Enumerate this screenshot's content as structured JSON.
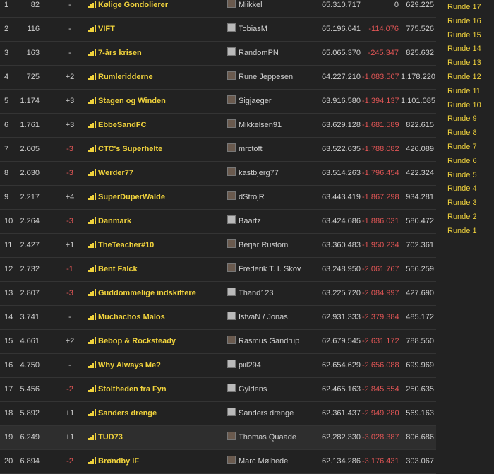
{
  "standings": [
    {
      "rank": "1",
      "prev": "82",
      "move": "-",
      "team": "Kølige Gondolierer",
      "user": "Miikkel",
      "avatar": "dark",
      "points": "65.310.717",
      "diff": "0",
      "last": "629.225"
    },
    {
      "rank": "2",
      "prev": "116",
      "move": "-",
      "team": "VIFT",
      "user": "TobiasM",
      "avatar": "light",
      "points": "65.196.641",
      "diff": "-114.076",
      "last": "775.526"
    },
    {
      "rank": "3",
      "prev": "163",
      "move": "-",
      "team": "7-års krisen",
      "user": "RandomPN",
      "avatar": "light",
      "points": "65.065.370",
      "diff": "-245.347",
      "last": "825.632"
    },
    {
      "rank": "4",
      "prev": "725",
      "move": "+2",
      "team": "Rumleridderne",
      "user": "Rune Jeppesen",
      "avatar": "dark",
      "points": "64.227.210",
      "diff": "-1.083.507",
      "last": "1.178.220"
    },
    {
      "rank": "5",
      "prev": "1.174",
      "move": "+3",
      "team": "Stagen og Winden",
      "user": "Sigjaeger",
      "avatar": "dark",
      "points": "63.916.580",
      "diff": "-1.394.137",
      "last": "1.101.085"
    },
    {
      "rank": "6",
      "prev": "1.761",
      "move": "+3",
      "team": "EbbeSandFC",
      "user": "Mikkelsen91",
      "avatar": "dark",
      "points": "63.629.128",
      "diff": "-1.681.589",
      "last": "822.615"
    },
    {
      "rank": "7",
      "prev": "2.005",
      "move": "-3",
      "team": "CTC's Superhelte",
      "user": "mrctoft",
      "avatar": "dark",
      "points": "63.522.635",
      "diff": "-1.788.082",
      "last": "426.089"
    },
    {
      "rank": "8",
      "prev": "2.030",
      "move": "-3",
      "team": "Werder77",
      "user": "kastbjerg77",
      "avatar": "dark",
      "points": "63.514.263",
      "diff": "-1.796.454",
      "last": "422.324"
    },
    {
      "rank": "9",
      "prev": "2.217",
      "move": "+4",
      "team": "SuperDuperWalde",
      "user": "dStrojR",
      "avatar": "dark",
      "points": "63.443.419",
      "diff": "-1.867.298",
      "last": "934.281"
    },
    {
      "rank": "10",
      "prev": "2.264",
      "move": "-3",
      "team": "Danmark",
      "user": "Baartz",
      "avatar": "light",
      "points": "63.424.686",
      "diff": "-1.886.031",
      "last": "580.472"
    },
    {
      "rank": "11",
      "prev": "2.427",
      "move": "+1",
      "team": "TheTeacher#10",
      "user": "Berjar Rustom",
      "avatar": "dark",
      "points": "63.360.483",
      "diff": "-1.950.234",
      "last": "702.361"
    },
    {
      "rank": "12",
      "prev": "2.732",
      "move": "-1",
      "team": "Bent Falck",
      "user": "Frederik T. I. Skov",
      "avatar": "dark",
      "points": "63.248.950",
      "diff": "-2.061.767",
      "last": "556.259"
    },
    {
      "rank": "13",
      "prev": "2.807",
      "move": "-3",
      "team": "Guddommelige indskiftere",
      "user": "Thand123",
      "avatar": "light",
      "points": "63.225.720",
      "diff": "-2.084.997",
      "last": "427.690"
    },
    {
      "rank": "14",
      "prev": "3.741",
      "move": "-",
      "team": "Muchachos Malos",
      "user": "IstvaN / Jonas",
      "avatar": "light",
      "points": "62.931.333",
      "diff": "-2.379.384",
      "last": "485.172"
    },
    {
      "rank": "15",
      "prev": "4.661",
      "move": "+2",
      "team": "Bebop & Rocksteady",
      "user": "Rasmus Gandrup",
      "avatar": "dark",
      "points": "62.679.545",
      "diff": "-2.631.172",
      "last": "788.550"
    },
    {
      "rank": "16",
      "prev": "4.750",
      "move": "-",
      "team": "Why Always Me?",
      "user": "piil294",
      "avatar": "light",
      "points": "62.654.629",
      "diff": "-2.656.088",
      "last": "699.969"
    },
    {
      "rank": "17",
      "prev": "5.456",
      "move": "-2",
      "team": "Stoltheden fra Fyn",
      "user": "Gyldens",
      "avatar": "light",
      "points": "62.465.163",
      "diff": "-2.845.554",
      "last": "250.635"
    },
    {
      "rank": "18",
      "prev": "5.892",
      "move": "+1",
      "team": "Sanders drenge",
      "user": "Sanders drenge",
      "avatar": "light",
      "points": "62.361.437",
      "diff": "-2.949.280",
      "last": "569.163"
    },
    {
      "rank": "19",
      "prev": "6.249",
      "move": "+1",
      "team": "TUD73",
      "user": "Thomas Quaade",
      "avatar": "dark",
      "points": "62.282.330",
      "diff": "-3.028.387",
      "last": "806.686"
    },
    {
      "rank": "20",
      "prev": "6.894",
      "move": "-2",
      "team": "Brøndby IF",
      "user": "Marc Mølhede",
      "avatar": "dark",
      "points": "62.134.286",
      "diff": "-3.176.431",
      "last": "303.067"
    }
  ],
  "highlight_rank": "19",
  "rounds": [
    "Runde 17",
    "Runde 16",
    "Runde 15",
    "Runde 14",
    "Runde 13",
    "Runde 12",
    "Runde 11",
    "Runde 10",
    "Runde 9",
    "Runde 8",
    "Runde 7",
    "Runde 6",
    "Runde 5",
    "Runde 4",
    "Runde 3",
    "Runde 2",
    "Runde 1"
  ],
  "colors": {
    "accent": "#f0d23c",
    "negative": "#e05555",
    "background": "#222222"
  },
  "icons": {
    "team": "bar-chart-icon"
  }
}
